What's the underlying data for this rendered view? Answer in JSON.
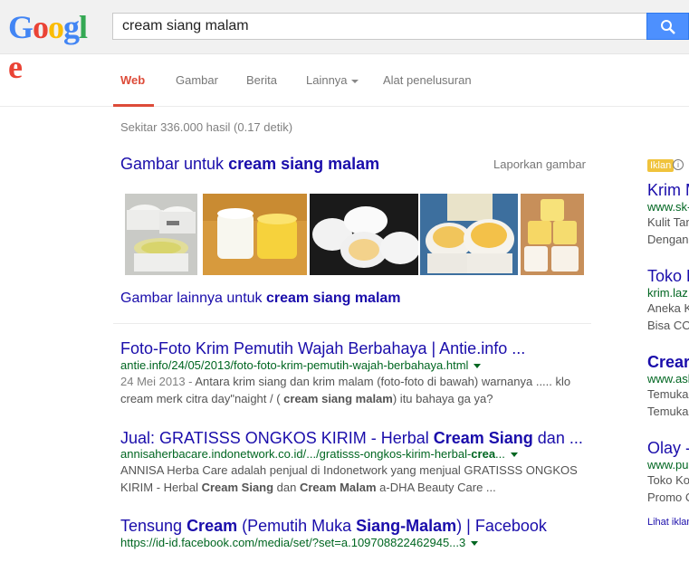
{
  "header": {
    "logo_letters": [
      "G",
      "o",
      "o",
      "g",
      "l",
      "e"
    ],
    "search_value": "cream siang malam"
  },
  "tabs": [
    {
      "label": "Web",
      "active": true
    },
    {
      "label": "Gambar",
      "active": false
    },
    {
      "label": "Berita",
      "active": false
    },
    {
      "label": "Lainnya",
      "active": false
    },
    {
      "label": "Alat penelusuran",
      "active": false
    }
  ],
  "stats": "Sekitar 336.000 hasil (0.17 detik)",
  "images": {
    "heading_prefix": "Gambar untuk ",
    "heading_query": "cream siang malam",
    "report_label": "Laporkan gambar",
    "more_prefix": "Gambar lainnya untuk ",
    "more_query": "cream siang malam"
  },
  "results": [
    {
      "title_parts": [
        {
          "t": "Foto-Foto Krim Pemutih Wajah Berbahaya | Antie.info ...",
          "b": false
        }
      ],
      "url": "antie.info/24/05/2013/foto-foto-krim-pemutih-wajah-berbahaya.html",
      "snippet_line1_date": "24 Mei 2013 - ",
      "snippet_line1": "Antara krim siang dan krim malam (foto-foto di bawah) warnanya ..... klo",
      "snippet_line2_parts": [
        {
          "t": "cream merk citra day\"naight / ( ",
          "b": false
        },
        {
          "t": "cream siang malam",
          "b": true
        },
        {
          "t": ") itu bahaya ga ya?",
          "b": false
        }
      ]
    },
    {
      "title_parts": [
        {
          "t": "Jual: GRATISSS ONGKOS KIRIM - Herbal ",
          "b": false
        },
        {
          "t": "Cream Siang",
          "b": true
        },
        {
          "t": " dan ...",
          "b": false
        }
      ],
      "url_parts": [
        {
          "t": "annisaherbacare.indonetwork.co.id/.../gratisss-ongkos-kirim-herbal-",
          "b": false
        },
        {
          "t": "crea",
          "b": true
        },
        {
          "t": "...",
          "b": false
        }
      ],
      "snippet_line1": "ANNISA Herba Care adalah penjual di Indonetwork yang menjual GRATISSS ONGKOS",
      "snippet_line2_parts": [
        {
          "t": "KIRIM - Herbal ",
          "b": false
        },
        {
          "t": "Cream Siang",
          "b": true
        },
        {
          "t": " dan ",
          "b": false
        },
        {
          "t": "Cream Malam",
          "b": true
        },
        {
          "t": " a-DHA Beauty Care ...",
          "b": false
        }
      ]
    },
    {
      "title_parts": [
        {
          "t": "Tensung ",
          "b": false
        },
        {
          "t": "Cream",
          "b": true
        },
        {
          "t": " (Pemutih Muka ",
          "b": false
        },
        {
          "t": "Siang-Malam",
          "b": true
        },
        {
          "t": ") | Facebook",
          "b": false
        }
      ],
      "url": "https://id-id.facebook.com/media/set/?set=a.109708822462945...3"
    }
  ],
  "ads": {
    "badge": "Iklan",
    "items": [
      {
        "title": "Krim M",
        "url": "www.sk-",
        "lines": [
          "Kulit Tan",
          "Dengan"
        ]
      },
      {
        "title": "Toko K",
        "url": "krim.laz",
        "lines": [
          "Aneka K",
          "Bisa CO"
        ]
      },
      {
        "title": "Crear",
        "url": "www.asl",
        "lines": [
          "Temuka",
          "Temuka"
        ]
      },
      {
        "title": "Olay -",
        "url": "www.pus",
        "lines": [
          "Toko Ko",
          "Promo C"
        ]
      }
    ],
    "more": "Lihat iklan"
  },
  "colors": {
    "link": "#1a0dab",
    "url_green": "#006621",
    "tab_active": "#dd4b39",
    "search_button": "#4d90fe",
    "ad_badge": "#f0c33c"
  },
  "icons": {
    "search_button": "magnifier-icon",
    "dropdown": "caret-down-icon",
    "ad_info": "info-icon"
  }
}
